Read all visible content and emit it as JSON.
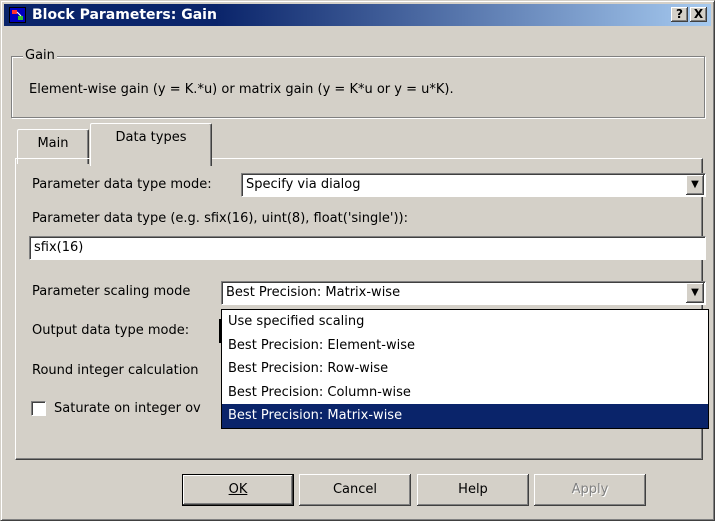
{
  "window": {
    "title": "Block Parameters: Gain",
    "help_button": "?",
    "close_button": "X"
  },
  "group": {
    "legend": "Gain",
    "description": "Element-wise gain (y = K.*u) or matrix gain (y = K*u or y = u*K)."
  },
  "tabs": [
    {
      "label": "Main",
      "active": false
    },
    {
      "label": "Data types",
      "active": true
    }
  ],
  "form": {
    "param_dtype_mode_label": "Parameter data type mode:",
    "param_dtype_mode_value": "Specify via dialog",
    "param_dtype_label": "Parameter data type (e.g. sfix(16), uint(8), float('single')):",
    "param_dtype_value": "sfix(16)",
    "param_scaling_mode_label": "Parameter scaling mode",
    "param_scaling_mode_value": "Best Precision: Matrix-wise",
    "output_dtype_mode_label": "Output data type mode:",
    "round_label": "Round integer calculation",
    "saturate_label": "Saturate on integer ov",
    "saturate_checked": false
  },
  "scaling_options": [
    {
      "label": "Use specified scaling"
    },
    {
      "label": "Best Precision: Element-wise"
    },
    {
      "label": "Best Precision: Row-wise"
    },
    {
      "label": "Best Precision: Column-wise"
    },
    {
      "label": "Best Precision: Matrix-wise",
      "selected": true
    }
  ],
  "buttons": {
    "ok": "OK",
    "cancel": "Cancel",
    "help": "Help",
    "apply": "Apply"
  },
  "colors": {
    "title_bar": "#0a246a",
    "selection": "#0a246a",
    "face": "#d4d0c8"
  }
}
